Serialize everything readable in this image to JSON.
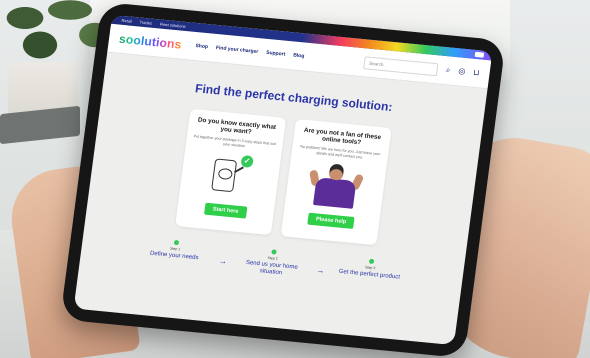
{
  "topbar": {
    "links": [
      "Retail",
      "Trades",
      "Fleet solutions"
    ]
  },
  "navbar": {
    "logo": "soolutions",
    "links": [
      "Shop",
      "Find your charger",
      "Support",
      "Blog"
    ],
    "search_placeholder": "Search"
  },
  "hero": {
    "title": "Find the perfect charging solution:"
  },
  "cards": [
    {
      "title": "Do you know exactly what you want?",
      "subtitle": "Put together your package in 3 easy steps that suit your situation",
      "button": "Start here"
    },
    {
      "title": "Are you not a fan of these online tools?",
      "subtitle": "No problem! We are here for you. Just leave your details and we'll contact you.",
      "button": "Please help"
    }
  ],
  "steps": [
    {
      "num": "Step 1",
      "title": "Define your needs"
    },
    {
      "num": "Step 2",
      "title": "Send us your home situation"
    },
    {
      "num": "Step 3",
      "title": "Get the perfect product"
    }
  ],
  "colors": {
    "brand_blue": "#2a35a8",
    "accent_green": "#2fcf4a"
  }
}
